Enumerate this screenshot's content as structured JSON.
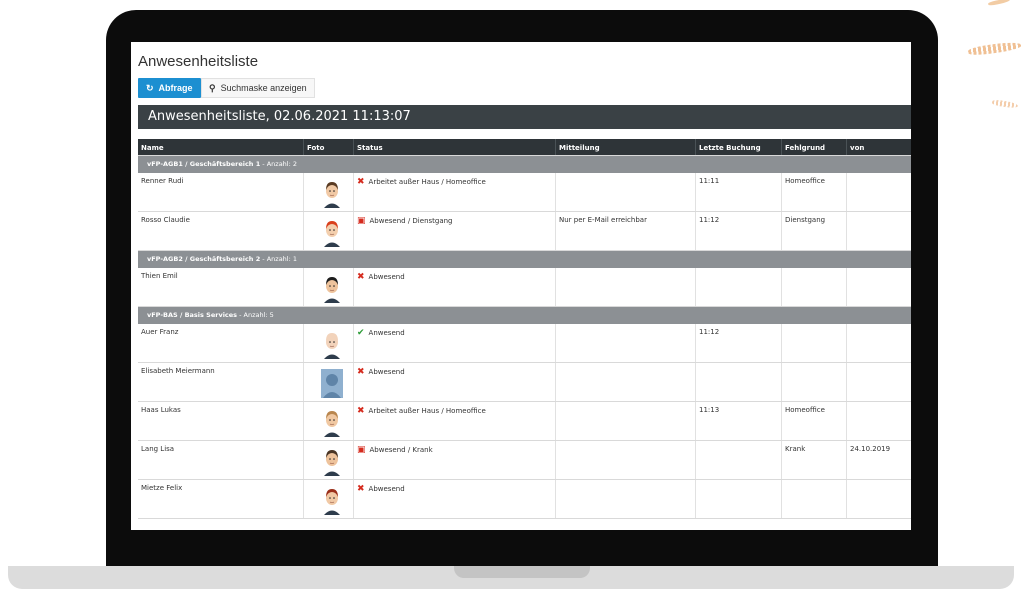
{
  "page": {
    "title": "Anwesenheitsliste",
    "query_button": "Abfrage",
    "search_button": "Suchmaske anzeigen",
    "panel_heading": "Anwesenheitsliste, 02.06.2021 11:13:07"
  },
  "table": {
    "columns": [
      "Name",
      "Foto",
      "Status",
      "Mitteilung",
      "Letzte Buchung",
      "Fehlgrund",
      "von"
    ],
    "groups": [
      {
        "title": "vFP-AGB1 / Geschäftsbereich 1",
        "count": " - Anzahl: 2",
        "rows": [
          {
            "name": "Renner Rudi",
            "status_icon": "x-icon",
            "status": "Arbeitet außer Haus / Homeoffice",
            "message": "",
            "last": "11:11",
            "reason": "Homeoffice",
            "from": ""
          },
          {
            "name": "Rosso Claudie",
            "status_icon": "calendar-icon",
            "status": "Abwesend / Dienstgang",
            "message": "Nur per E-Mail erreichbar",
            "last": "11:12",
            "reason": "Dienstgang",
            "from": ""
          }
        ]
      },
      {
        "title": "vFP-AGB2 / Geschäftsbereich 2",
        "count": " - Anzahl: 1",
        "rows": [
          {
            "name": "Thien Emil",
            "status_icon": "x-icon",
            "status": "Abwesend",
            "message": "",
            "last": "",
            "reason": "",
            "from": ""
          }
        ]
      },
      {
        "title": "vFP-BAS / Basis Services",
        "count": " - Anzahl: 5",
        "rows": [
          {
            "name": "Auer Franz",
            "status_icon": "check-icon",
            "status": "Anwesend",
            "message": "",
            "last": "11:12",
            "reason": "",
            "from": ""
          },
          {
            "name": "Elisabeth Meiermann",
            "status_icon": "x-icon",
            "status": "Abwesend",
            "message": "",
            "last": "",
            "reason": "",
            "from": ""
          },
          {
            "name": "Haas Lukas",
            "status_icon": "x-icon",
            "status": "Arbeitet außer Haus / Homeoffice",
            "message": "",
            "last": "11:13",
            "reason": "Homeoffice",
            "from": ""
          },
          {
            "name": "Lang Lisa",
            "status_icon": "calendar-icon",
            "status": "Abwesend / Krank",
            "message": "",
            "last": "",
            "reason": "Krank",
            "from": "24.10.2019"
          },
          {
            "name": "Mietze Felix",
            "status_icon": "x-icon",
            "status": "Abwesend",
            "message": "",
            "last": "",
            "reason": "",
            "from": ""
          }
        ]
      }
    ]
  },
  "colors": {
    "primary_button": "#1c8fd1",
    "panel_header": "#3a4145",
    "group_row": "#8c9094",
    "status_absent": "#d52b1e",
    "status_present": "#2a9b35"
  }
}
